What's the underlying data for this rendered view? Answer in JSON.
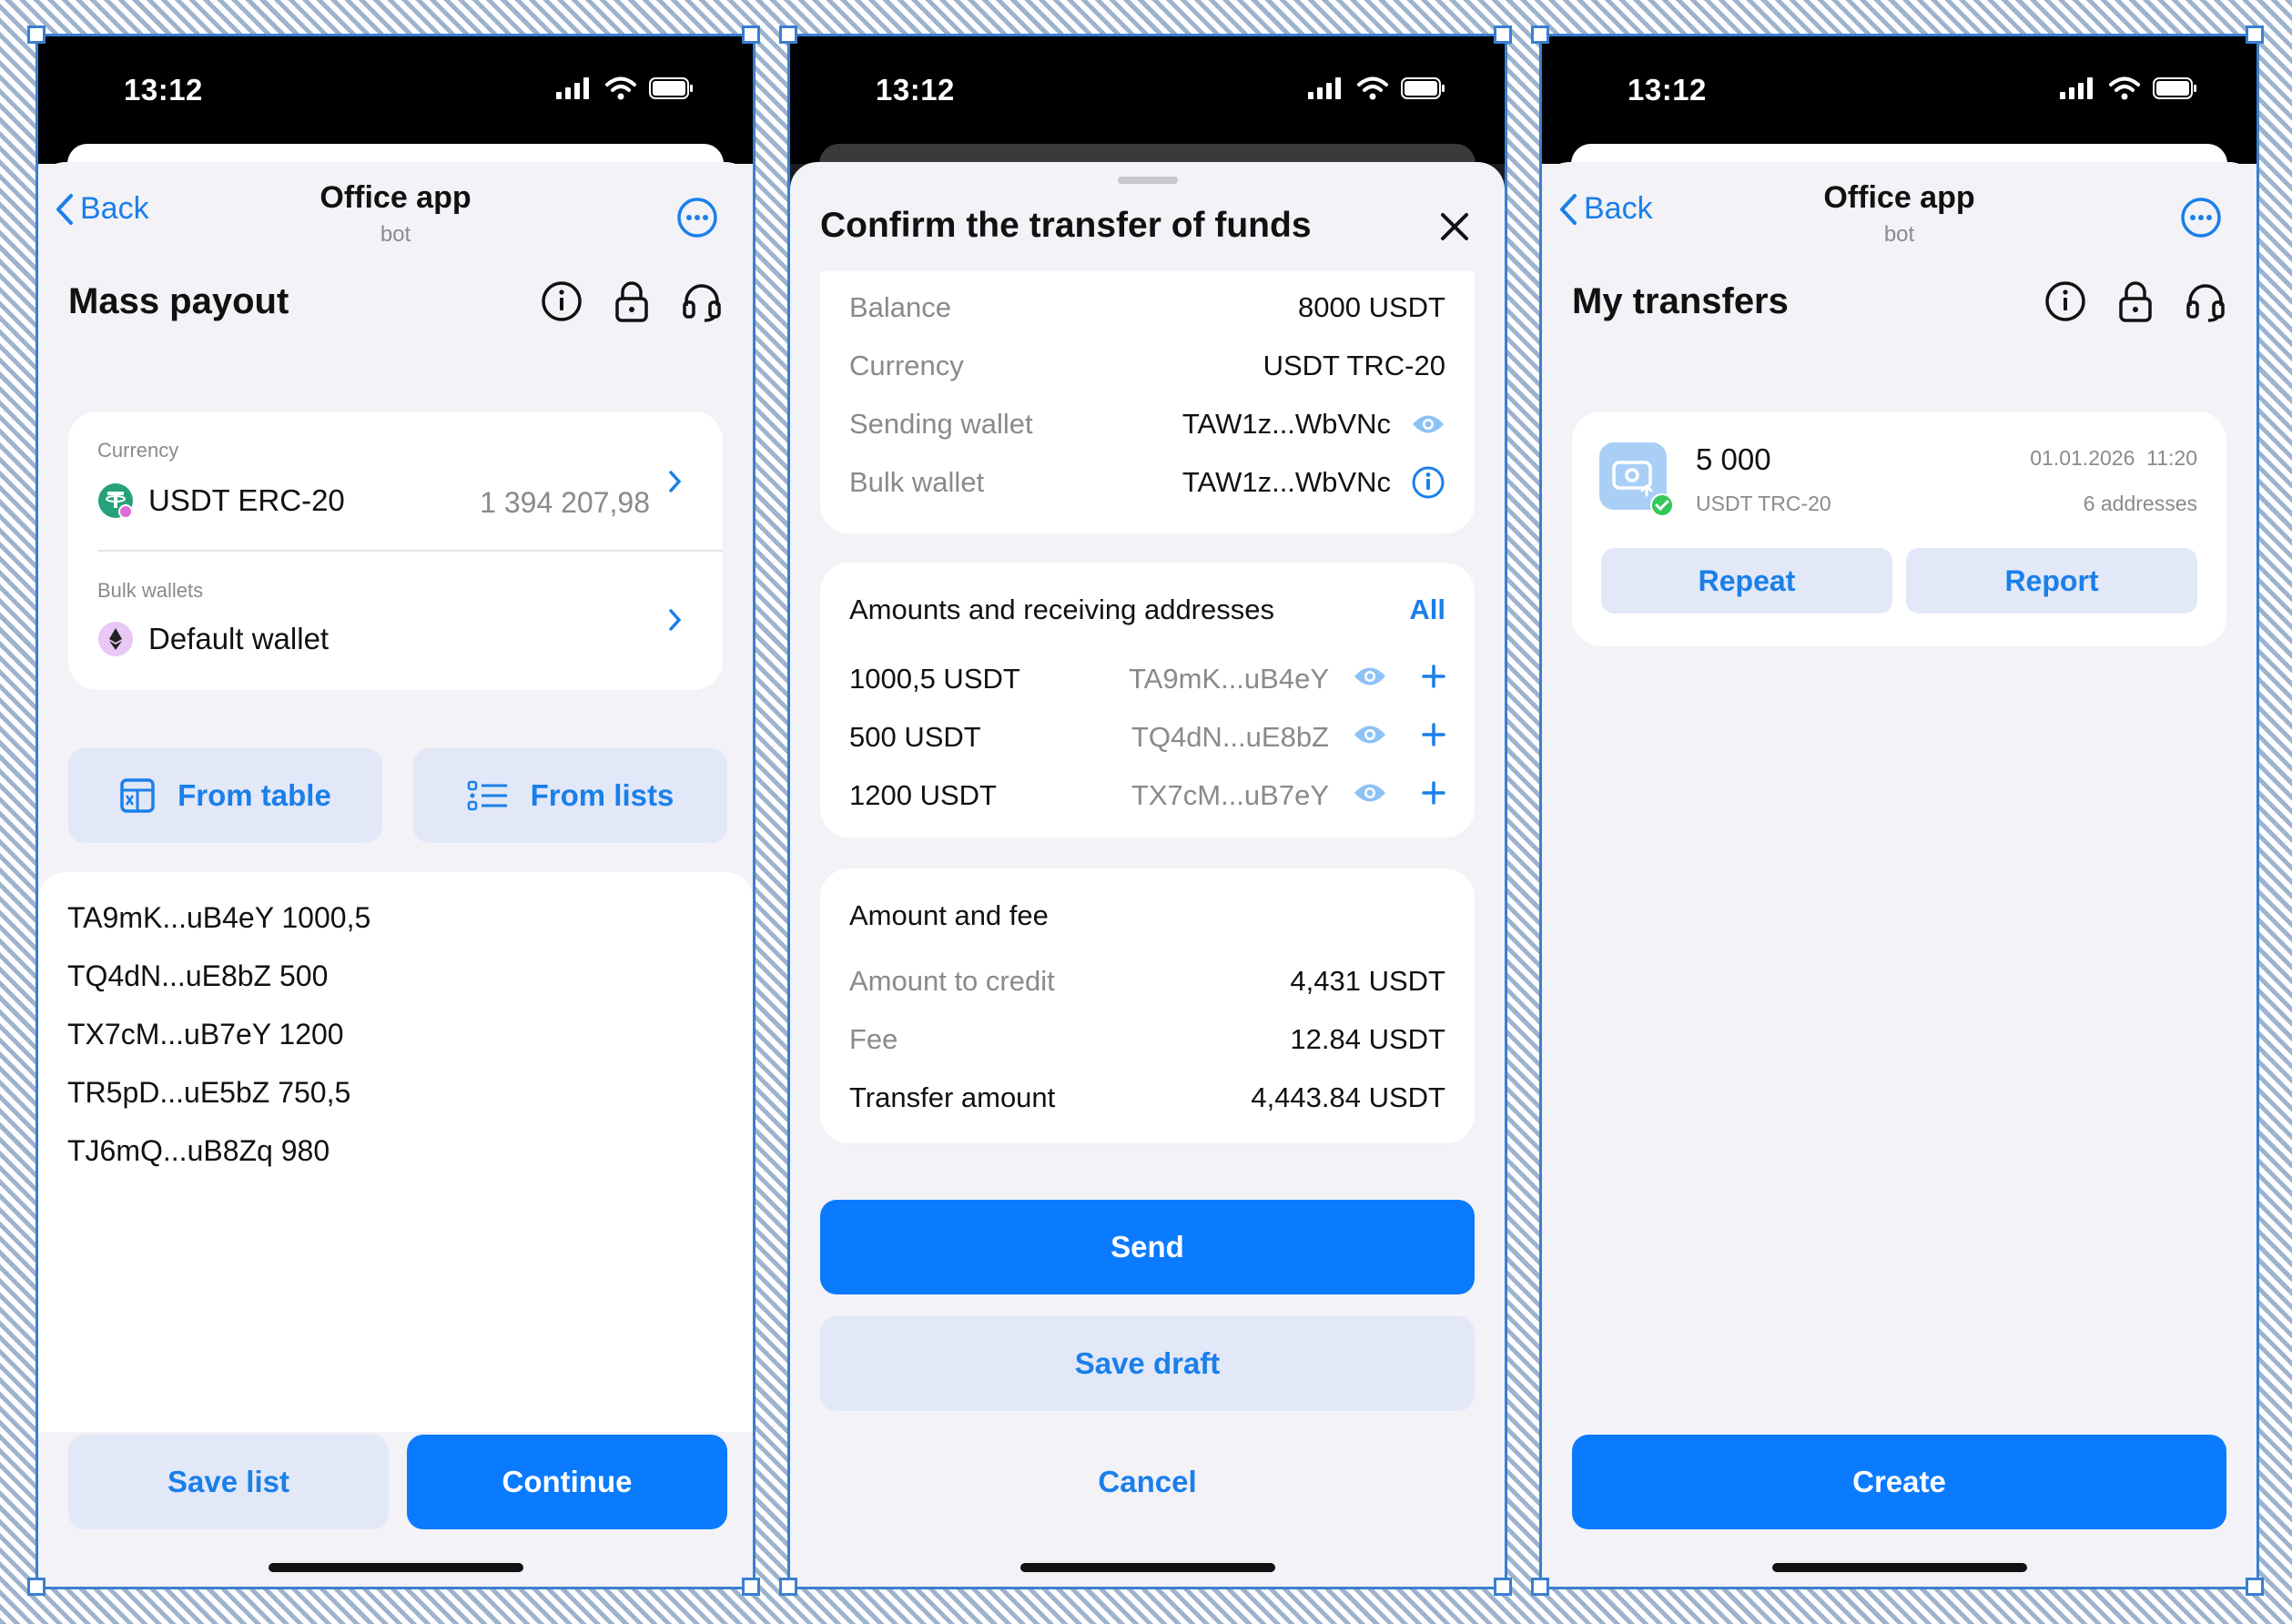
{
  "status": {
    "time": "13:12"
  },
  "colors": {
    "accent": "#0a7bff",
    "link": "#1a7fea",
    "secondary_bg": "#e2e8f7",
    "success": "#34c759"
  },
  "screen1": {
    "nav": {
      "back": "Back",
      "title": "Office app",
      "subtitle": "bot"
    },
    "page_title": "Mass payout",
    "currency": {
      "label": "Currency",
      "name": "USDT ERC-20",
      "amount": "1 394 207,98"
    },
    "bulk": {
      "label": "Bulk wallets",
      "name": "Default wallet"
    },
    "from_table": "From table",
    "from_lists": "From lists",
    "lines": [
      "TA9mK...uB4eY 1000,5",
      "TQ4dN...uE8bZ 500",
      "TX7cM...uB7eY 1200",
      "TR5pD...uE5bZ 750,5",
      "TJ6mQ...uB8Zq 980"
    ],
    "save_list": "Save  list",
    "continue": "Continue"
  },
  "screen2": {
    "title": "Confirm the transfer of funds",
    "summary": [
      {
        "k": "Balance",
        "v": "8000 USDT"
      },
      {
        "k": "Currency",
        "v": "USDT TRC-20"
      },
      {
        "k": "Sending wallet",
        "v": "TAW1z...WbVNc"
      },
      {
        "k": "Bulk wallet",
        "v": "TAW1z...WbVNc"
      }
    ],
    "amounts_title": "Amounts and receiving addresses",
    "all": "All",
    "amounts": [
      {
        "amount": "1000,5 USDT",
        "addr": "TA9mK...uB4eY"
      },
      {
        "amount": "500 USDT",
        "addr": "TQ4dN...uE8bZ"
      },
      {
        "amount": "1200 USDT",
        "addr": "TX7cM...uB7eY"
      }
    ],
    "fee_title": "Amount and fee",
    "fee_rows": [
      {
        "k": "Amount to credit",
        "v": "4,431 USDT"
      },
      {
        "k": "Fee",
        "v": "12.84 USDT"
      },
      {
        "k": "Transfer amount",
        "v": "4,443.84  USDT"
      }
    ],
    "send": "Send",
    "save_draft": "Save draft",
    "cancel": "Cancel"
  },
  "screen3": {
    "nav": {
      "back": "Back",
      "title": "Office app",
      "subtitle": "bot"
    },
    "page_title": "My transfers",
    "transfer": {
      "amount": "5 000",
      "currency": "USDT TRC-20",
      "date": "01.01.2026  11:20",
      "addresses": "6 addresses",
      "repeat": "Repeat",
      "report": "Report"
    },
    "create": "Create"
  }
}
